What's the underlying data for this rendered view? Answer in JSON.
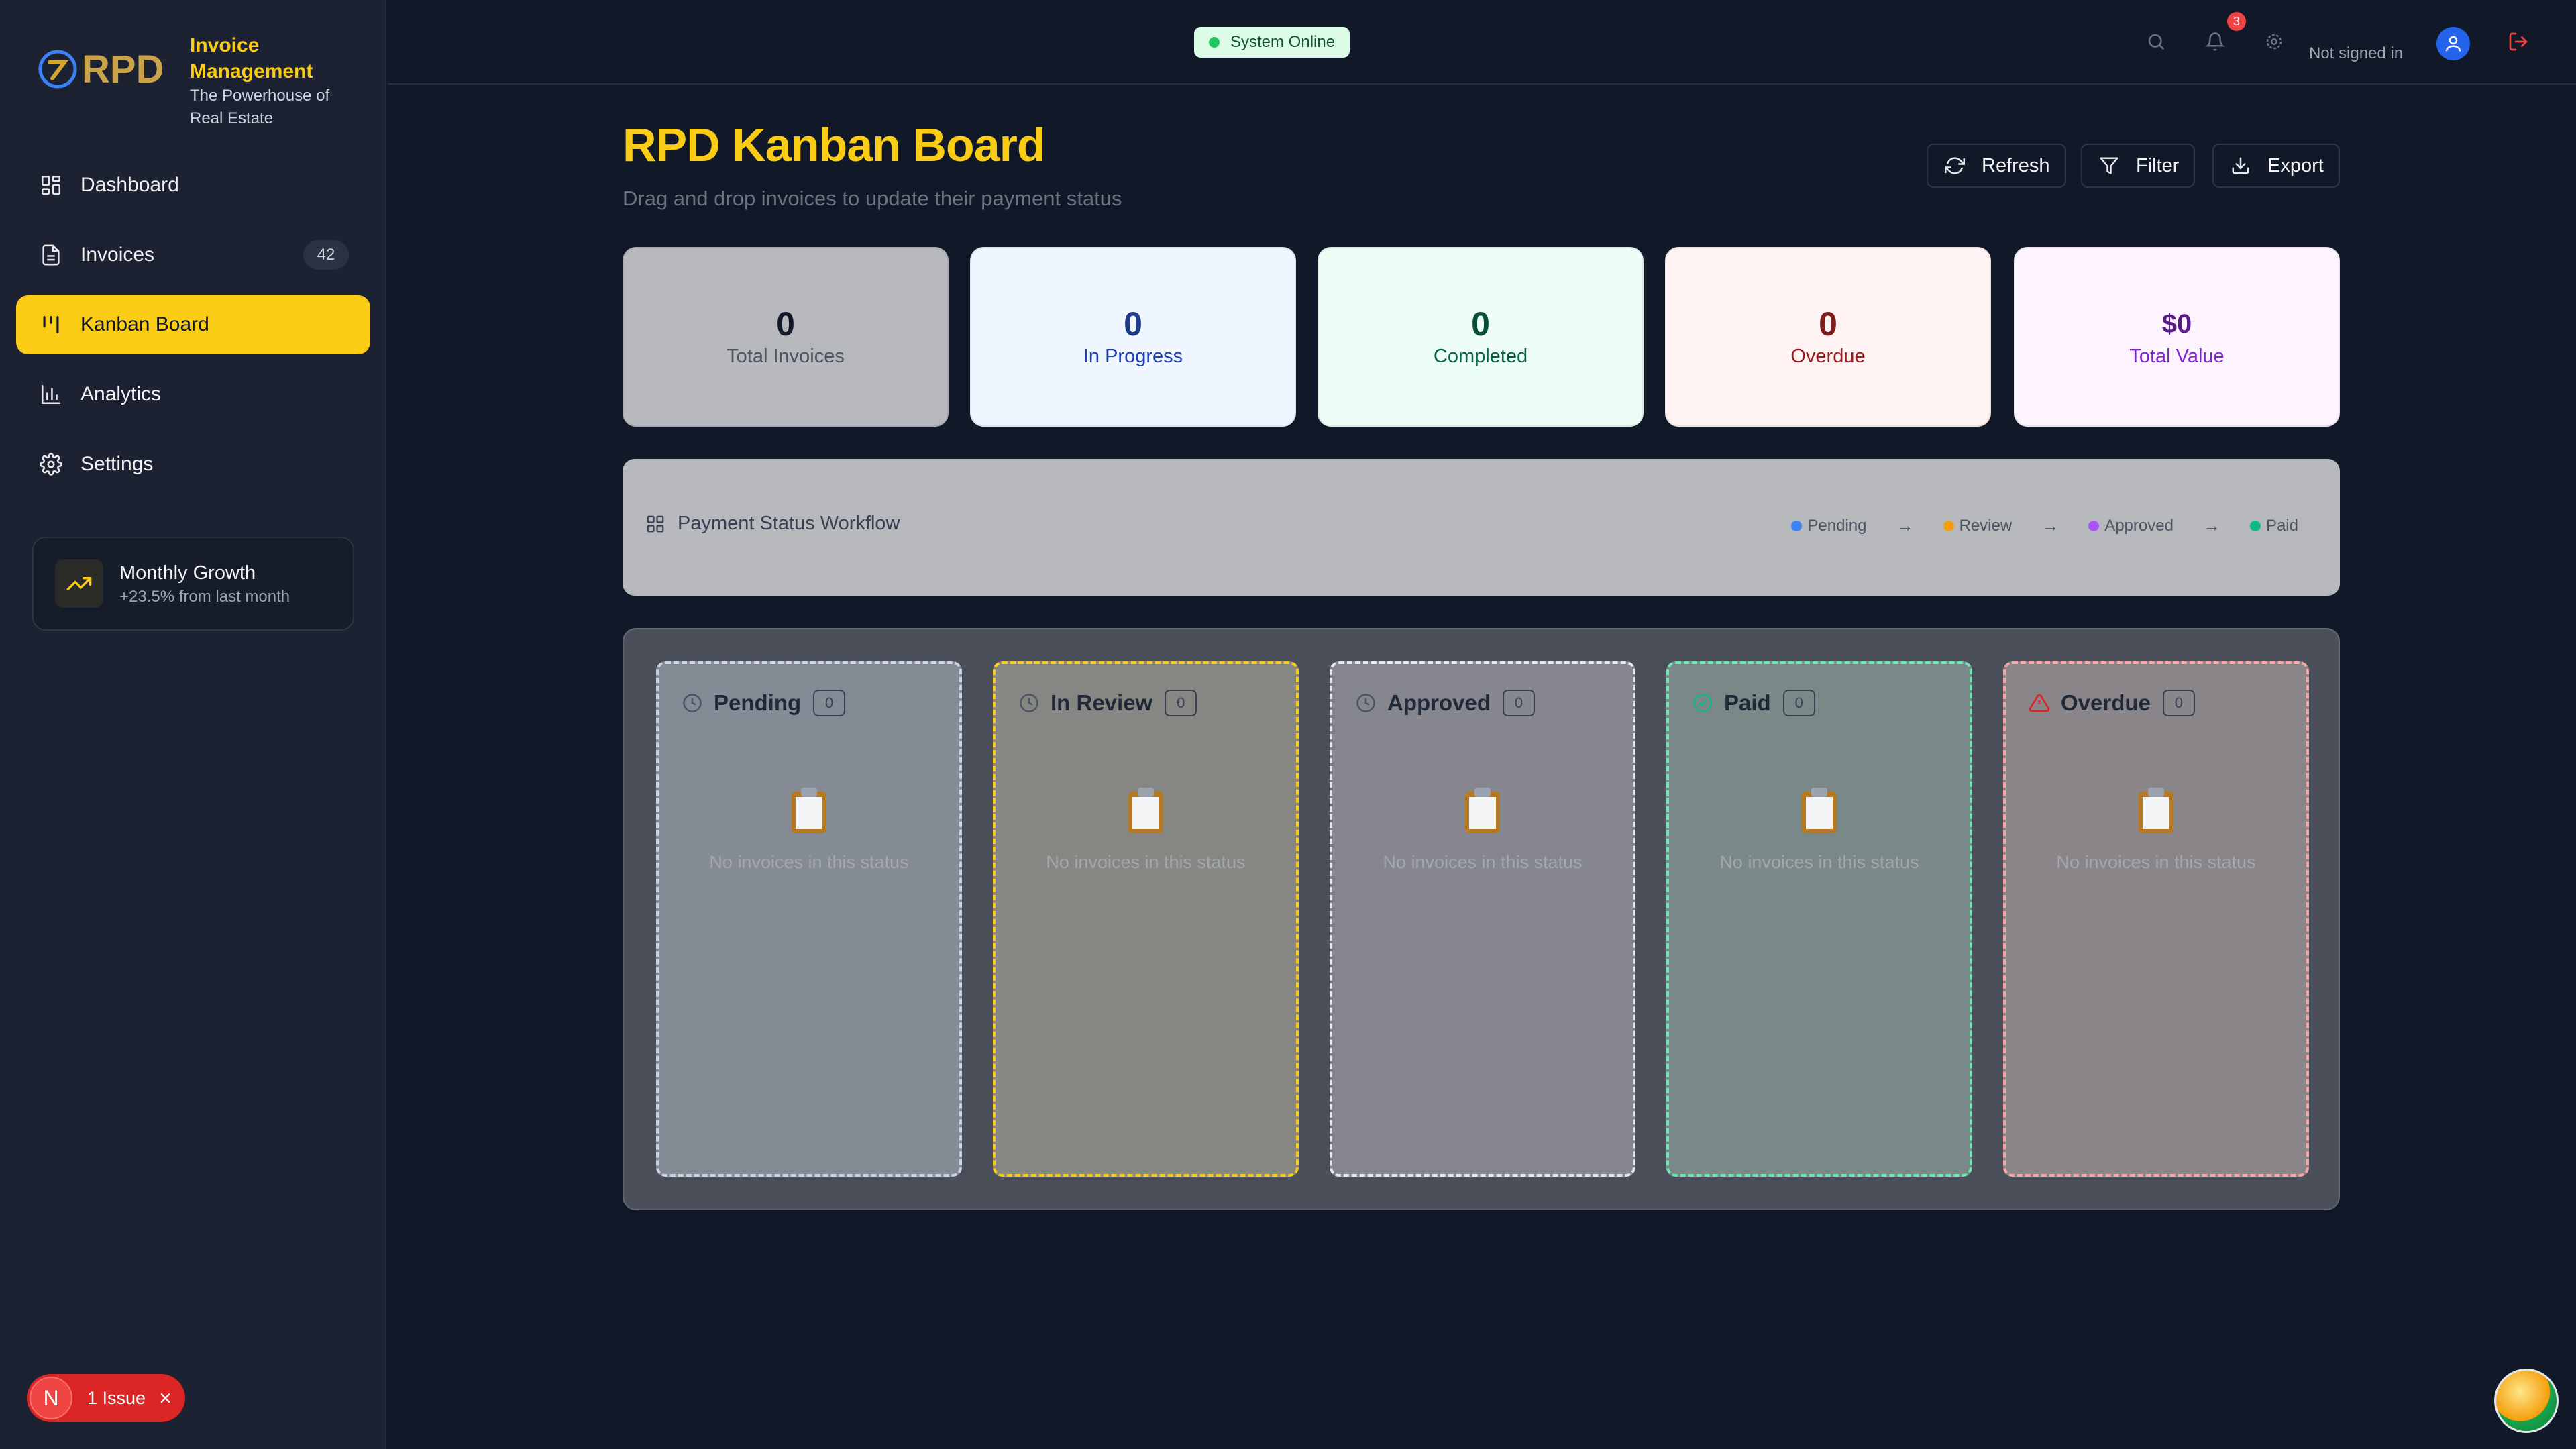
{
  "brand": {
    "logo_text": "RPD",
    "title": "Invoice Management",
    "subtitle": "The Powerhouse of Real Estate"
  },
  "nav": [
    {
      "label": "Dashboard",
      "icon": "grid-icon",
      "active": false
    },
    {
      "label": "Invoices",
      "icon": "document-icon",
      "badge": "42",
      "active": false
    },
    {
      "label": "Kanban Board",
      "icon": "kanban-icon",
      "active": true
    },
    {
      "label": "Analytics",
      "icon": "bar-chart-icon",
      "active": false
    },
    {
      "label": "Settings",
      "icon": "gear-icon",
      "active": false
    }
  ],
  "growth": {
    "title": "Monthly Growth",
    "subtitle": "+23.5% from last month"
  },
  "issue": {
    "letter": "N",
    "label": "1 Issue"
  },
  "topbar": {
    "status": "System Online",
    "notifications": "3",
    "user_status": "Not signed in"
  },
  "page": {
    "title": "RPD Kanban Board",
    "subtitle": "Drag and drop invoices to update their payment status",
    "buttons": {
      "refresh": "Refresh",
      "filter": "Filter",
      "export": "Export"
    }
  },
  "stats": [
    {
      "value": "0",
      "label": "Total Invoices",
      "bg": "#b8b9bd",
      "fg": "#111827",
      "label_fg": "#4b5563"
    },
    {
      "value": "0",
      "label": "In Progress",
      "bg": "#eff6ff",
      "fg": "#1e3a8a",
      "label_fg": "#1e40af"
    },
    {
      "value": "0",
      "label": "Completed",
      "bg": "#ecfdf5",
      "fg": "#064e3b",
      "label_fg": "#065f46"
    },
    {
      "value": "0",
      "label": "Overdue",
      "bg": "#fef2f2",
      "fg": "#7f1d1d",
      "label_fg": "#991b1b"
    },
    {
      "value": "$0",
      "label": "Total Value",
      "bg": "#fdf4ff",
      "fg": "#581c87",
      "label_fg": "#7e22ce"
    }
  ],
  "workflow": {
    "title": "Payment Status Workflow",
    "steps": [
      {
        "label": "Pending",
        "color": "#3b82f6"
      },
      {
        "label": "Review",
        "color": "#f59e0b"
      },
      {
        "label": "Approved",
        "color": "#a855f7"
      },
      {
        "label": "Paid",
        "color": "#10b981"
      }
    ]
  },
  "columns": [
    {
      "title": "Pending",
      "count": "0",
      "icon": "clock-icon",
      "empty": "No invoices in this status",
      "bg": "#858b95",
      "border": "#cbd5e1"
    },
    {
      "title": "In Review",
      "count": "0",
      "icon": "clock-icon",
      "empty": "No invoices in this status",
      "bg": "#868782",
      "border": "#facc15"
    },
    {
      "title": "Approved",
      "count": "0",
      "icon": "clock-icon",
      "empty": "No invoices in this status",
      "bg": "#86868f",
      "border": "#e5e7eb"
    },
    {
      "title": "Paid",
      "count": "0",
      "icon": "check-circle-icon",
      "empty": "No invoices in this status",
      "bg": "#7a8987",
      "border": "#6ee7b7"
    },
    {
      "title": "Overdue",
      "count": "0",
      "icon": "warning-icon",
      "empty": "No invoices in this status",
      "bg": "#8a8589",
      "border": "#fca5a5"
    }
  ]
}
